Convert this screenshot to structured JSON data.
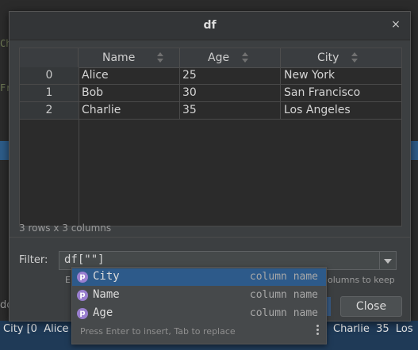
{
  "background": {
    "frag1": "Ch",
    "frag2": "Fr",
    "frag3": "do",
    "bottom_left": "City [0  Alice",
    "bottom_right": "Charlie  35  Los"
  },
  "dialog": {
    "title": "df",
    "close_glyph": "×",
    "table": {
      "columns": [
        "Name",
        "Age",
        "City"
      ],
      "rows": [
        {
          "index": "0",
          "name": "Alice",
          "age": "25",
          "city": "New York"
        },
        {
          "index": "1",
          "name": "Bob",
          "age": "30",
          "city": "San Francisco"
        },
        {
          "index": "2",
          "name": "Charlie",
          "age": "35",
          "city": "Los Angeles"
        }
      ]
    },
    "rows_info": "3 rows x 3 columns",
    "filter": {
      "label": "Filter:",
      "value": "df[\"\"]"
    },
    "hint_left": "E",
    "hint_right": "olumns to keep",
    "close_button": "Close"
  },
  "completion": {
    "options": [
      {
        "icon": "p",
        "name": "City",
        "type": "column name"
      },
      {
        "icon": "p",
        "name": "Name",
        "type": "column name"
      },
      {
        "icon": "p",
        "name": "Age",
        "type": "column name"
      }
    ],
    "footer": "Press Enter to insert, Tab to replace"
  }
}
